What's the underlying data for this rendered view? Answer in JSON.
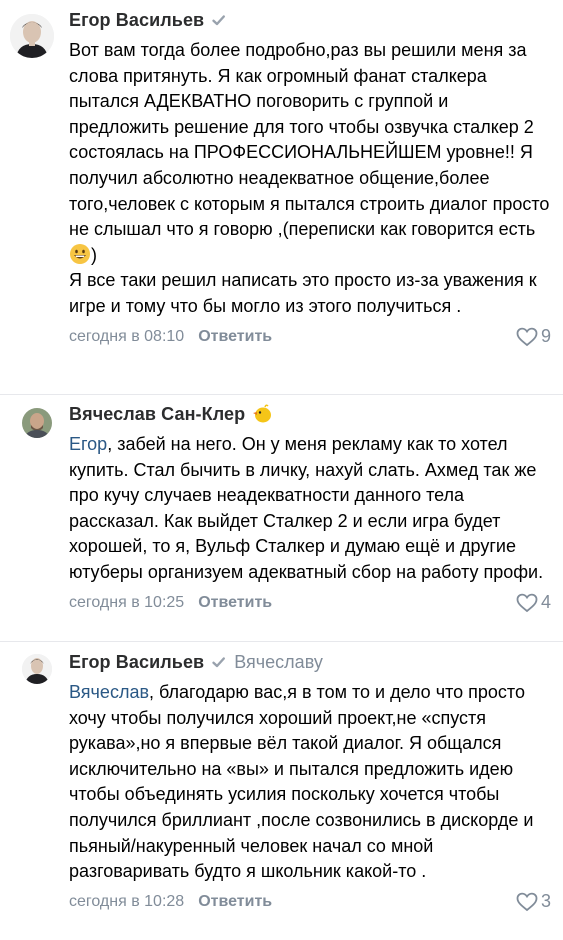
{
  "comments": [
    {
      "author": "Егор Васильев",
      "verified": true,
      "reply_to": "",
      "text_before": "Вот вам тогда более подробно,раз вы решили меня за слова притянуть. Я как огромный фанат сталкера пытался АДЕКВАТНО поговорить с группой и предложить решение для того чтобы озвучка сталкер 2 состоялась на ПРОФЕССИОНАЛЬНЕЙШЕМ уровне!! Я получил абсолютно неадекватное общение,более того,человек с которым я пытался строить диалог просто не слышал что я говорю ,(переписки как говорится есть",
      "text_emoji": "grinning-face-emoji",
      "text_after": ")\nЯ все таки решил написать это просто из-за уважения к игре и тому что бы могло из этого получиться .",
      "time": "сегодня в 08:10",
      "reply_label": "Ответить",
      "likes": "9"
    },
    {
      "author": "Вячеслав Сан-Клер",
      "badge": "chick-emoji",
      "mention": "Егор",
      "text": ", забей на него. Он у меня рекламу как то хотел купить. Стал бычить в личку, нахуй слать. Ахмед так же про кучу случаев неадекватности данного тела рассказал. Как выйдет Сталкер 2 и если игра будет хорошей, то я, Вульф Сталкер и думаю ещё и другие ютуберы организуем адекватный сбор на работу профи.",
      "time": "сегодня в 10:25",
      "reply_label": "Ответить",
      "likes": "4"
    },
    {
      "author": "Егор Васильев",
      "verified": true,
      "reply_to": "Вячеславу",
      "mention": "Вячеслав",
      "text": ", благодарю вас,я в том то и дело что просто хочу чтобы получился хороший проект,не «спустя рукава»,но я впервые вёл такой диалог. Я общался исключительно на «вы» и пытался предложить идею чтобы объединять усилия поскольку хочется чтобы получился бриллиант ,после созвонились в дискорде и пьяный/накуренный человек начал со мной разговаривать будто я школьник какой-то .",
      "time": "сегодня в 10:28",
      "reply_label": "Ответить",
      "likes": "3"
    }
  ],
  "colors": {
    "link": "#2a5885",
    "meta": "#818c99",
    "verified": "#99a2ad",
    "separator": "#e7e8ec"
  },
  "icons": [
    "verified-check-icon",
    "heart-outline-icon",
    "chick-emoji",
    "grinning-face-emoji"
  ]
}
